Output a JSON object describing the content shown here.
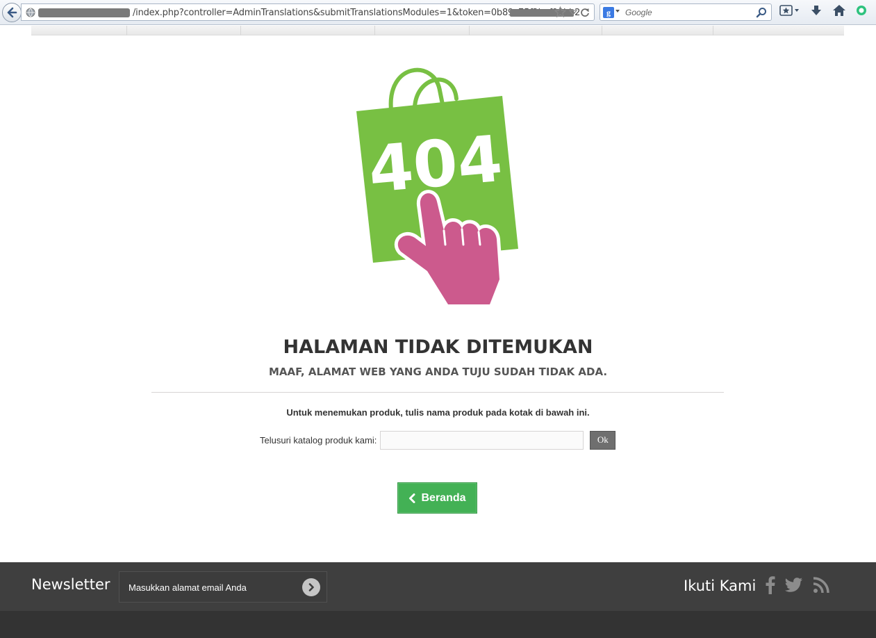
{
  "browser": {
    "url": "/index.php?controller=AdminTranslations&submitTranslationsModules=1&token=0b89c75f2bef90bb2",
    "search_placeholder": "Google"
  },
  "page": {
    "image_text": "404",
    "title": "HALAMAN TIDAK DITEMUKAN",
    "subtitle": "MAAF, ALAMAT WEB YANG ANDA TUJU SUDAH TIDAK ADA.",
    "hint": "Untuk menemukan produk, tulis nama produk pada kotak di bawah ini.",
    "search_label": "Telusuri katalog produk kami:",
    "search_value": "",
    "ok_label": "Ok",
    "home_label": "Beranda"
  },
  "footer": {
    "newsletter_title": "Newsletter",
    "newsletter_placeholder": "Masukkan alamat email Anda",
    "follow_title": "Ikuti Kami"
  },
  "colors": {
    "bag_green": "#78c043",
    "hand_pink": "#cc5a8d",
    "button_green": "#43b155",
    "footer_bg": "#3f3f3f"
  }
}
